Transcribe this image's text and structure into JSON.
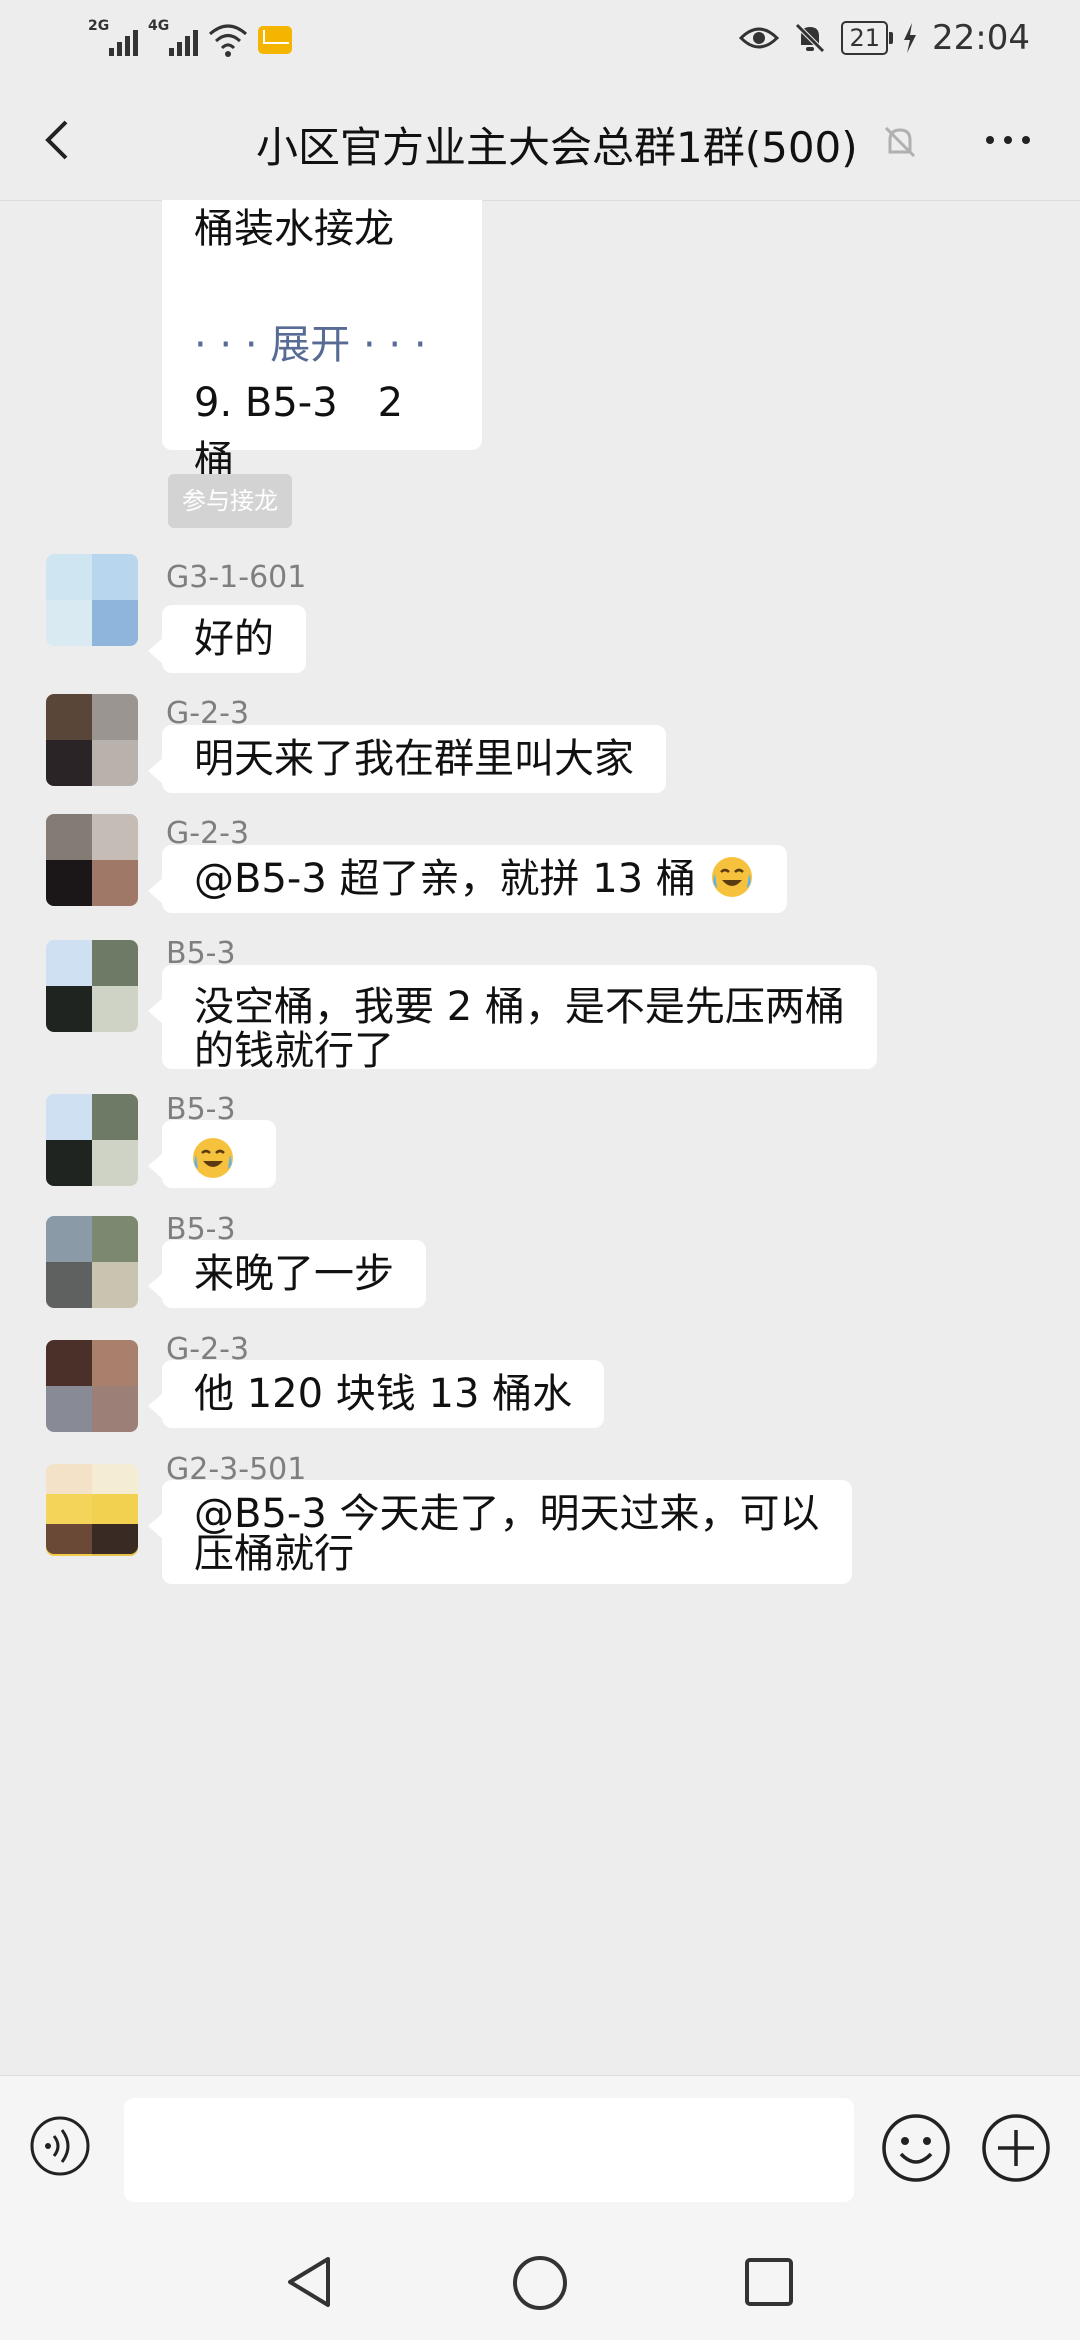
{
  "status_bar": {
    "sim1": "2G",
    "sim2": "4G",
    "battery": "21",
    "time": "22:04"
  },
  "header": {
    "title": "小区官方业主大会总群1群(500)"
  },
  "chat": {
    "top_bubble": {
      "line1": "桶装水接龙",
      "expand": "· · · 展开 · · ·",
      "line3": "9. B5-3　2 桶"
    },
    "join_button": "参与接龙",
    "messages": [
      {
        "sender": "G3-1-601",
        "text": "好的"
      },
      {
        "sender": "G-2-3",
        "text": "明天来了我在群里叫大家"
      },
      {
        "sender": "G-2-3",
        "text": "@B5-3  超了亲，就拼 13 桶"
      },
      {
        "sender": "B5-3",
        "line1": "没空桶，我要 2 桶，是不是先压两桶",
        "line2": "的钱就行了"
      },
      {
        "sender": "B5-3",
        "text": ""
      },
      {
        "sender": "B5-3",
        "text": "来晚了一步"
      },
      {
        "sender": "G-2-3",
        "text": "他 120 块钱 13 桶水"
      },
      {
        "sender": "G2-3-501",
        "line1": "@B5-3  今天走了，明天过来，可以",
        "line2": "压桶就行"
      }
    ]
  },
  "colors": {
    "background": "#ededed",
    "bubble": "#ffffff",
    "link": "#576b95",
    "sender_name": "#7f7f7f"
  },
  "icons": [
    "back-icon",
    "mute-bell-icon",
    "more-icon",
    "voice-icon",
    "emoji-icon",
    "plus-icon",
    "laughing-crying-emoji"
  ]
}
